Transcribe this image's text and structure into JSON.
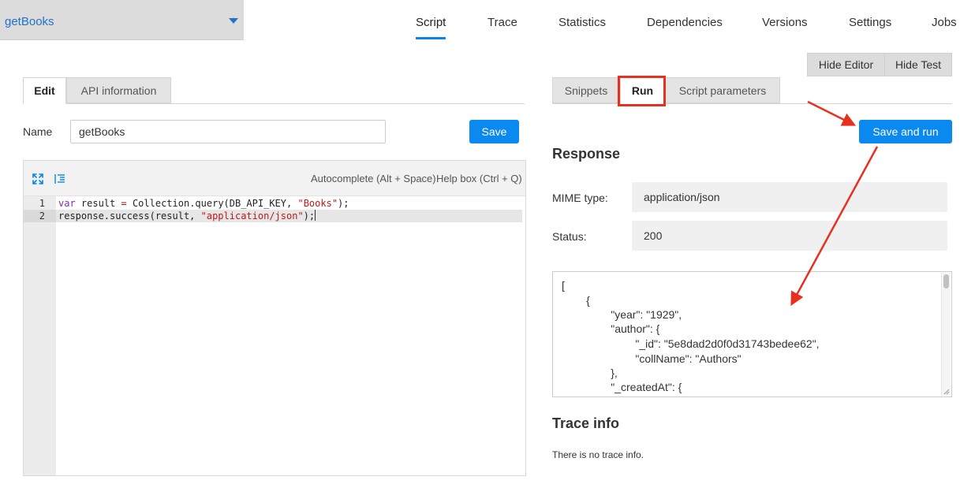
{
  "api_selector": {
    "name": "getBooks"
  },
  "nav": {
    "tabs": [
      {
        "label": "Script"
      },
      {
        "label": "Trace"
      },
      {
        "label": "Statistics"
      },
      {
        "label": "Dependencies"
      },
      {
        "label": "Versions"
      },
      {
        "label": "Settings"
      },
      {
        "label": "Jobs"
      }
    ],
    "active": "Script"
  },
  "view_toggles": {
    "hide_editor": "Hide Editor",
    "hide_test": "Hide Test"
  },
  "editor_tabs": [
    {
      "label": "Edit"
    },
    {
      "label": "API information"
    }
  ],
  "name_field": {
    "label": "Name",
    "value": "getBooks"
  },
  "save_label": "Save",
  "editor_toolbar": {
    "fullscreen_icon": "expand-arrows-icon",
    "indent_icon": "format-indent-icon",
    "autocomplete_hint": "Autocomplete (Alt + Space)",
    "helpbox_hint": "Help box (Ctrl + Q)"
  },
  "code": {
    "line_numbers": [
      "1",
      "2"
    ],
    "line1": {
      "keyword": "var",
      "ident": " result ",
      "op": "=",
      "call": " Collection.query(DB_API_KEY, ",
      "str": "\"Books\"",
      "end": ");"
    },
    "line2": {
      "call": "response.success(result, ",
      "str": "\"application/json\"",
      "end": ");"
    }
  },
  "test_tabs": [
    {
      "label": "Snippets"
    },
    {
      "label": "Run"
    },
    {
      "label": "Script parameters"
    }
  ],
  "save_and_run_label": "Save and run",
  "response": {
    "heading": "Response",
    "mime_label": "MIME type:",
    "mime_value": "application/json",
    "status_label": "Status:",
    "status_value": "200",
    "body_lines": [
      "[",
      "        {",
      "                \"year\": \"1929\",",
      "                \"author\": {",
      "                        \"_id\": \"5e8dad2d0f0d31743bedee62\",",
      "                        \"collName\": \"Authors\"",
      "                },",
      "                \"_createdAt\": {"
    ]
  },
  "trace": {
    "heading": "Trace info",
    "message": "There is no trace info."
  },
  "colors": {
    "accent": "#0a8af0",
    "annotation": "#e83020",
    "link": "#1f73c8"
  }
}
